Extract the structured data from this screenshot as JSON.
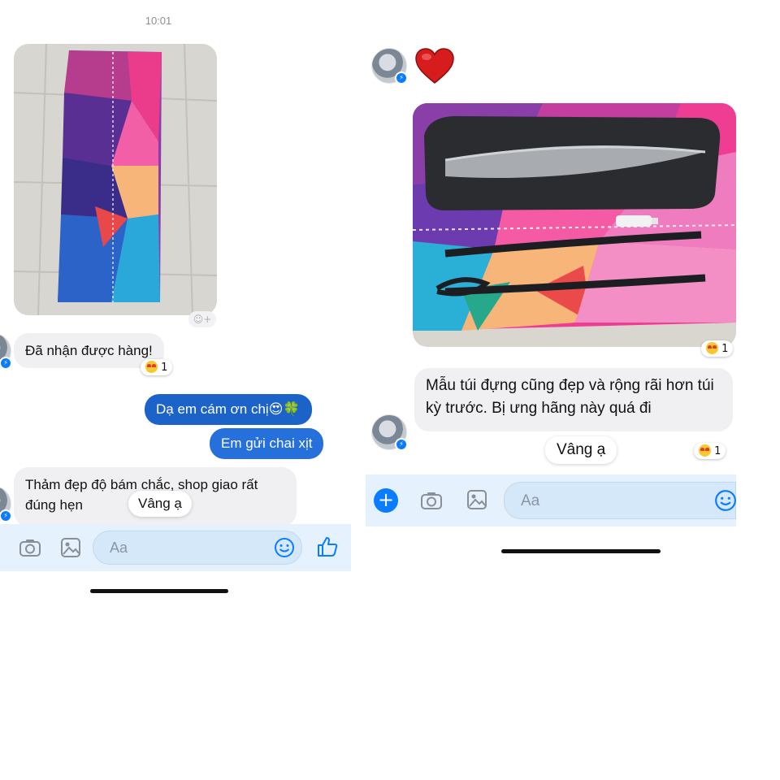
{
  "left": {
    "time": "10:01",
    "messages": {
      "received_1": "Đã nhận được hàng!",
      "sent_1": "Dạ em cám ơn chị😍🍀",
      "sent_2": "Em gửi chai xịt",
      "received_2": "Thảm đẹp độ bám chắc, shop giao rất đúng hẹn"
    },
    "reaction_count": "1",
    "suggestion": "Vâng ạ",
    "composer": {
      "placeholder": "Aa"
    }
  },
  "right": {
    "messages": {
      "received_1": "Mẫu túi đựng cũng đẹp và rộng rãi hơn túi kỳ trước. Bị ưng hãng này quá đi"
    },
    "photo_reaction_count": "1",
    "message_reaction_count": "1",
    "suggestion": "Vâng ạ",
    "composer": {
      "placeholder": "Aa"
    }
  },
  "icons": {
    "heart": "heart-icon",
    "camera": "camera-icon",
    "gallery": "gallery-icon",
    "emoji": "emoji-icon",
    "like": "thumbs-up-icon",
    "plus": "plus-icon",
    "messenger_badge": "messenger-badge-icon"
  },
  "colors": {
    "accent": "#0a7cff",
    "incoming_bubble": "#f0f0f2",
    "composer_bg": "#e5f1fd"
  }
}
